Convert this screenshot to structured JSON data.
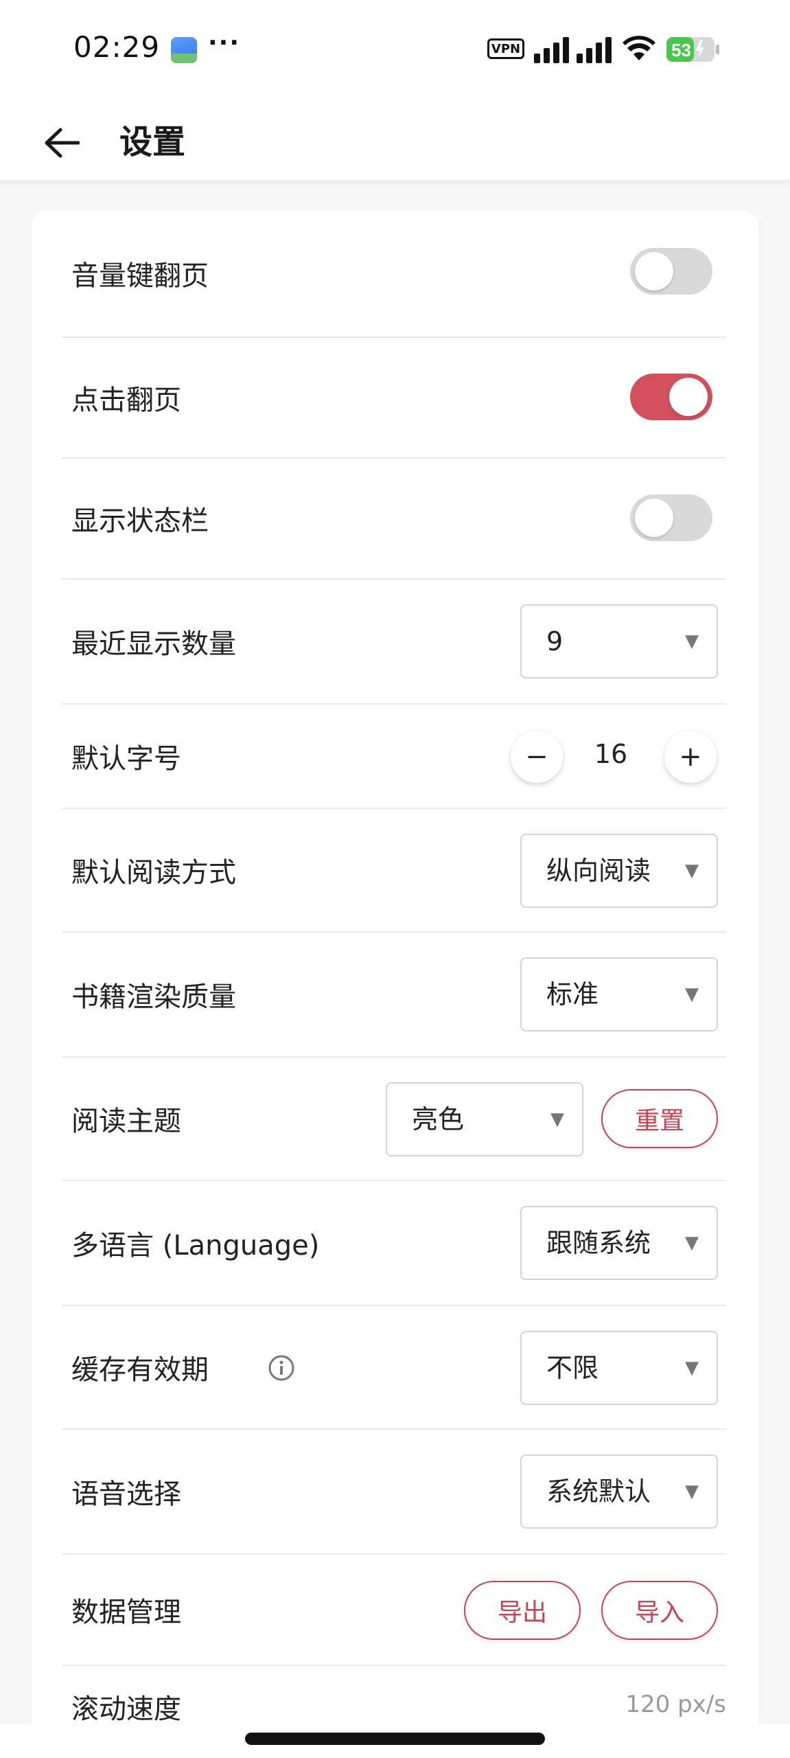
{
  "status_bar": {
    "time": "02:29",
    "dots": "···",
    "vpn": "VPN",
    "battery": "53"
  },
  "header": {
    "title": "设置",
    "back_icon": "arrow-left-icon"
  },
  "settings": {
    "volume_key_page": {
      "label": "音量键翻页",
      "on": false
    },
    "tap_page": {
      "label": "点击翻页",
      "on": true
    },
    "show_status_bar": {
      "label": "显示状态栏",
      "on": false
    },
    "recent_count": {
      "label": "最近显示数量",
      "value": "9"
    },
    "default_font_size": {
      "label": "默认字号",
      "value": "16",
      "minus": "−",
      "plus": "+"
    },
    "default_read_mode": {
      "label": "默认阅读方式",
      "value": "纵向阅读"
    },
    "render_quality": {
      "label": "书籍渲染质量",
      "value": "标准"
    },
    "read_theme": {
      "label": "阅读主题",
      "value": "亮色",
      "reset": "重置"
    },
    "language": {
      "label": "多语言 (Language)",
      "value": "跟随系统"
    },
    "cache_expiry": {
      "label": "缓存有效期",
      "value": "不限"
    },
    "voice": {
      "label": "语音选择",
      "value": "系统默认"
    },
    "data_management": {
      "label": "数据管理",
      "export": "导出",
      "import": "导入"
    },
    "scroll_speed": {
      "label": "滚动速度",
      "value": "120 px/s"
    }
  },
  "colors": {
    "accent": "#d2505d",
    "accent_text": "#c8434f"
  }
}
